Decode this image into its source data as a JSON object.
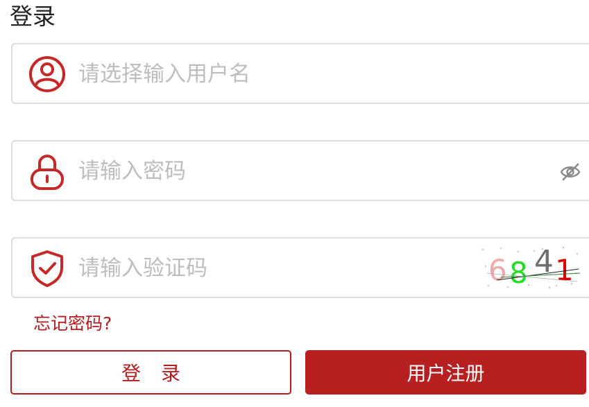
{
  "page": {
    "title": "登录"
  },
  "form": {
    "username": {
      "placeholder": "请选择输入用户名",
      "value": "",
      "icon": "user-icon"
    },
    "password": {
      "placeholder": "请输入密码",
      "value": "",
      "icon": "lock-icon",
      "toggle_icon": "eye-off-icon"
    },
    "captcha": {
      "placeholder": "请输入验证码",
      "value": "",
      "icon": "shield-check-icon",
      "image_text": "6841"
    },
    "forgot_link": "忘记密码?"
  },
  "buttons": {
    "login_label": "登 录",
    "register_label": "用户注册"
  },
  "colors": {
    "accent": "#b72020",
    "icon": "#c62828",
    "border": "#dcdcdc",
    "placeholder": "#bdbdbd"
  }
}
